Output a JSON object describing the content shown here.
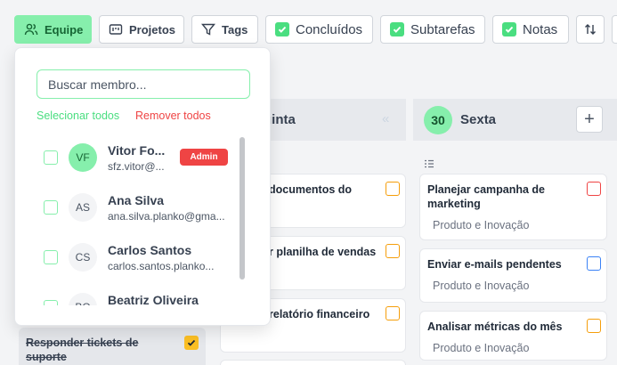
{
  "toolbar": {
    "team_label": "Equipe",
    "projects_label": "Projetos",
    "tags_label": "Tags",
    "toggles": {
      "completed": "Concluídos",
      "subtasks": "Subtarefas",
      "notes": "Notas"
    }
  },
  "dropdown": {
    "search_placeholder": "Buscar membro...",
    "select_all": "Selecionar todos",
    "remove_all": "Remover todos",
    "members": [
      {
        "initials": "VF",
        "name": "Vitor Fo...",
        "email": "sfz.vitor@...",
        "badge": "Admin"
      },
      {
        "initials": "AS",
        "name": "Ana Silva",
        "email": "ana.silva.planko@gma..."
      },
      {
        "initials": "CS",
        "name": "Carlos Santos",
        "email": "carlos.santos.planko..."
      },
      {
        "initials": "BO",
        "name": "Beatriz Oliveira",
        "email": ""
      }
    ]
  },
  "columns": {
    "thursday": {
      "day_name": "uinta",
      "cards": [
        {
          "title": "documentos do"
        },
        {
          "title": "r planilha de vendas"
        },
        {
          "title": "relatório financeiro"
        }
      ]
    },
    "friday": {
      "day_number": "30",
      "day_name": "Sexta",
      "add_symbol": "+",
      "cards": [
        {
          "title": "Planejar campanha de marketing",
          "project": "Produto e Inovação"
        },
        {
          "title": "Enviar e-mails pendentes",
          "project": "Produto e Inovação"
        },
        {
          "title": "Analisar métricas do mês",
          "project": "Produto e Inovação"
        }
      ]
    }
  },
  "left_card": {
    "title": "Responder tickets de suporte"
  },
  "colors": {
    "accent_green": "#86efac",
    "danger_red": "#ef4444",
    "warning_amber": "#f59e0b",
    "info_blue": "#3b82f6"
  },
  "icons": [
    "users-icon",
    "projects-icon",
    "filter-icon",
    "check-icon",
    "sort-icon",
    "chevrons-left-icon",
    "plus-icon",
    "list-icon"
  ]
}
